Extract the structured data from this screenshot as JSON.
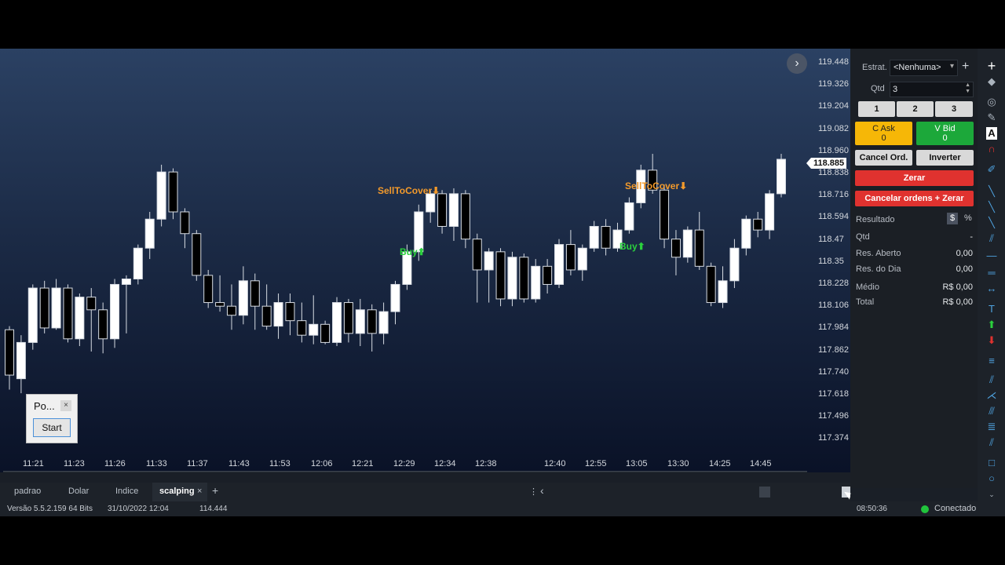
{
  "chart": {
    "prices": [
      "119.448",
      "119.326",
      "119.204",
      "119.082",
      "118.960",
      "118.838",
      "118.716",
      "118.594",
      "118.47",
      "118.35",
      "118.228",
      "118.106",
      "117.984",
      "117.862",
      "117.740",
      "117.618",
      "117.496",
      "117.374"
    ],
    "current_price": "118.885",
    "times": [
      "11:21",
      "11:23",
      "11:26",
      "11:33",
      "11:37",
      "11:43",
      "11:53",
      "12:06",
      "12:21",
      "12:29",
      "12:34",
      "12:38",
      "12:40",
      "12:55",
      "13:05",
      "13:30",
      "14:25",
      "14:45"
    ],
    "signals": {
      "sell1": "SellToCover",
      "buy1": "Buy",
      "sell2": "SellToCover",
      "buy2": "Buy"
    },
    "colors": {
      "up": "#ffffff",
      "down": "#000000",
      "sell": "#f39a2b",
      "buy": "#2bd13d"
    }
  },
  "chart_data": {
    "type": "candlestick",
    "y_unit": "price",
    "ylim": [
      117.25,
      119.5
    ],
    "candles": [
      [
        117.95,
        117.7,
        117.97,
        117.62
      ],
      [
        117.68,
        117.88,
        117.92,
        117.6
      ],
      [
        117.88,
        118.18,
        118.2,
        117.84
      ],
      [
        118.18,
        117.96,
        118.22,
        117.93
      ],
      [
        117.96,
        118.18,
        118.23,
        117.95
      ],
      [
        118.18,
        117.9,
        118.2,
        117.88
      ],
      [
        117.9,
        118.13,
        118.15,
        117.86
      ],
      [
        118.13,
        118.06,
        118.18,
        117.83
      ],
      [
        118.06,
        117.9,
        118.1,
        117.82
      ],
      [
        117.9,
        118.2,
        118.23,
        117.85
      ],
      [
        118.2,
        118.23,
        118.25,
        117.93
      ],
      [
        118.23,
        118.4,
        118.42,
        118.2
      ],
      [
        118.4,
        118.56,
        118.6,
        118.34
      ],
      [
        118.56,
        118.82,
        118.86,
        118.52
      ],
      [
        118.82,
        118.6,
        118.84,
        118.56
      ],
      [
        118.6,
        118.48,
        118.62,
        118.4
      ],
      [
        118.48,
        118.25,
        118.5,
        118.22
      ],
      [
        118.25,
        118.1,
        118.28,
        118.07
      ],
      [
        118.1,
        118.08,
        118.25,
        118.05
      ],
      [
        118.08,
        118.03,
        118.2,
        117.95
      ],
      [
        118.03,
        118.22,
        118.3,
        117.98
      ],
      [
        118.22,
        118.08,
        118.26,
        117.95
      ],
      [
        118.08,
        117.97,
        118.2,
        117.95
      ],
      [
        117.97,
        118.1,
        118.15,
        117.9
      ],
      [
        118.1,
        118.0,
        118.15,
        117.92
      ],
      [
        118.0,
        117.92,
        118.1,
        117.88
      ],
      [
        117.92,
        117.98,
        118.14,
        117.87
      ],
      [
        117.98,
        117.88,
        118.0,
        117.87
      ],
      [
        117.88,
        118.1,
        118.13,
        117.86
      ],
      [
        118.1,
        117.93,
        118.12,
        117.88
      ],
      [
        117.93,
        118.06,
        118.12,
        117.86
      ],
      [
        118.06,
        117.93,
        118.09,
        117.83
      ],
      [
        117.93,
        118.05,
        118.1,
        117.87
      ],
      [
        118.05,
        118.2,
        118.22,
        117.98
      ],
      [
        118.2,
        118.38,
        118.42,
        118.17
      ],
      [
        118.38,
        118.6,
        118.64,
        118.33
      ],
      [
        118.6,
        118.7,
        118.72,
        118.54
      ],
      [
        118.7,
        118.52,
        118.72,
        118.48
      ],
      [
        118.52,
        118.7,
        118.73,
        118.44
      ],
      [
        118.7,
        118.45,
        118.72,
        118.4
      ],
      [
        118.45,
        118.28,
        118.48,
        118.1
      ],
      [
        118.28,
        118.38,
        118.4,
        118.1
      ],
      [
        118.38,
        118.12,
        118.4,
        118.08
      ],
      [
        118.12,
        118.35,
        118.38,
        118.08
      ],
      [
        118.35,
        118.12,
        118.37,
        118.1
      ],
      [
        118.12,
        118.3,
        118.34,
        118.1
      ],
      [
        118.3,
        118.2,
        118.34,
        118.15
      ],
      [
        118.2,
        118.42,
        118.45,
        118.18
      ],
      [
        118.42,
        118.28,
        118.5,
        118.25
      ],
      [
        118.28,
        118.4,
        118.42,
        118.22
      ],
      [
        118.4,
        118.52,
        118.55,
        118.38
      ],
      [
        118.52,
        118.4,
        118.56,
        118.36
      ],
      [
        118.4,
        118.5,
        118.54,
        118.38
      ],
      [
        118.5,
        118.65,
        118.68,
        118.48
      ],
      [
        118.65,
        118.83,
        118.86,
        118.62
      ],
      [
        118.83,
        118.72,
        118.92,
        118.7
      ],
      [
        118.72,
        118.45,
        118.75,
        118.4
      ],
      [
        118.45,
        118.35,
        118.5,
        118.25
      ],
      [
        118.35,
        118.5,
        118.52,
        118.32
      ],
      [
        118.5,
        118.3,
        118.6,
        118.28
      ],
      [
        118.3,
        118.1,
        118.32,
        118.08
      ],
      [
        118.1,
        118.22,
        118.3,
        118.07
      ],
      [
        118.22,
        118.4,
        118.45,
        118.18
      ],
      [
        118.4,
        118.56,
        118.58,
        118.36
      ],
      [
        118.56,
        118.5,
        118.6,
        118.46
      ],
      [
        118.5,
        118.7,
        118.72,
        118.45
      ],
      [
        118.7,
        118.89,
        118.92,
        118.68
      ]
    ]
  },
  "pos_dialog": {
    "title": "Po...",
    "close": "×",
    "start": "Start"
  },
  "panel": {
    "estrat_label": "Estrat.",
    "estrat_value": "<Nenhuma>",
    "qtd_label": "Qtd",
    "qtd_value": "3",
    "q1": "1",
    "q2": "2",
    "q3": "3",
    "cask_label": "C Ask",
    "cask_value": "0",
    "vbid_label": "V Bid",
    "vbid_value": "0",
    "cancel_ord": "Cancel Ord.",
    "inverter": "Inverter",
    "zerar": "Zerar",
    "cancelar_zerar": "Cancelar ordens + Zerar",
    "resultado": "Resultado",
    "dollar": "$",
    "percent": "%",
    "rows": [
      {
        "label": "Qtd",
        "value": "-"
      },
      {
        "label": "Res. Aberto",
        "value": "0,00"
      },
      {
        "label": "Res. do Dia",
        "value": "0,00"
      },
      {
        "label": "Médio",
        "value": "R$ 0,00"
      },
      {
        "label": "Total",
        "value": "R$ 0,00"
      }
    ]
  },
  "tabs": [
    "padrao",
    "Dolar",
    "Indice",
    "scalping"
  ],
  "tab_close": "×",
  "tab_add": "+",
  "status": {
    "version": "Versão 5.5.2.159 64 Bits",
    "datetime": "31/10/2022 12:04",
    "value": "114.444",
    "clock": "08:50:36",
    "connection": "Conectado"
  },
  "nav": {
    "next": "›",
    "scroll_left": "‹",
    "scroll_dots": "⋮"
  }
}
